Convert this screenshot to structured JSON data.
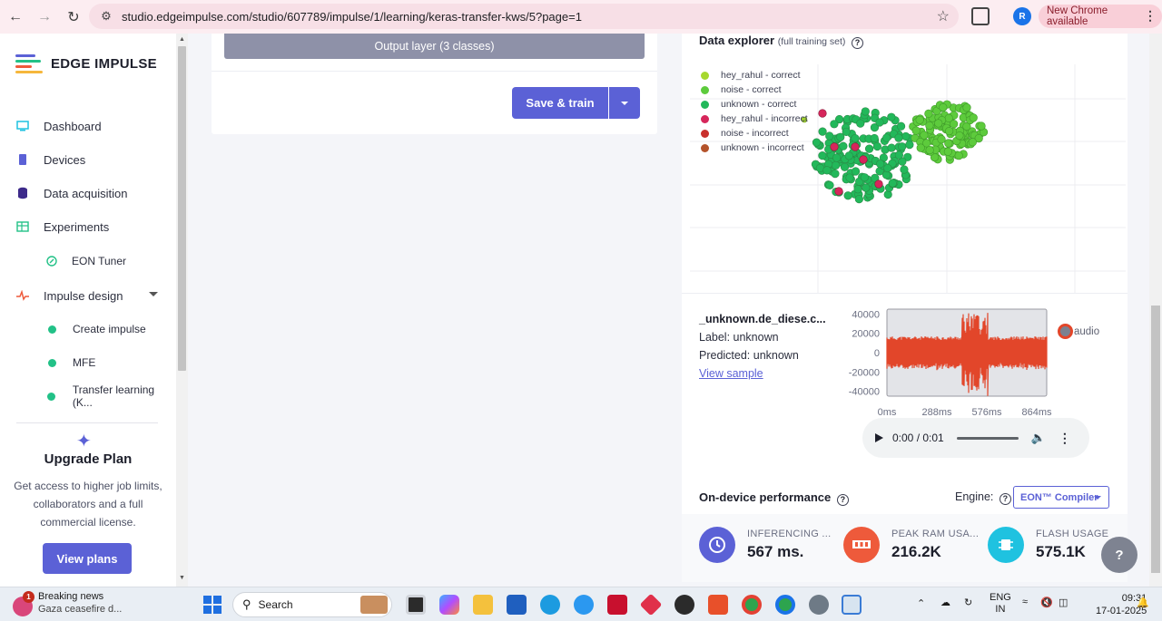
{
  "browser": {
    "url": "studio.edgeimpulse.com/studio/607789/impulse/1/learning/keras-transfer-kws/5?page=1",
    "profile_initial": "R",
    "new_chrome_label": "New Chrome available"
  },
  "sidebar": {
    "logo_text": "EDGE IMPULSE",
    "items": [
      {
        "label": "Dashboard",
        "icon": "monitor-icon"
      },
      {
        "label": "Devices",
        "icon": "chip-icon"
      },
      {
        "label": "Data acquisition",
        "icon": "database-icon"
      },
      {
        "label": "Experiments",
        "icon": "grid-icon"
      },
      {
        "label": "EON Tuner",
        "icon": "compass-icon"
      },
      {
        "label": "Impulse design",
        "icon": "pulse-icon"
      },
      {
        "label": "Create impulse",
        "icon": "dot-icon"
      },
      {
        "label": "MFE",
        "icon": "dot-icon"
      },
      {
        "label": "Transfer learning (K..."
      }
    ],
    "upgrade": {
      "title": "Upgrade Plan",
      "text": "Get access to higher job limits, collaborators and a full commercial license.",
      "button": "View plans"
    }
  },
  "main": {
    "output_layer": "Output layer (3 classes)",
    "save_train": "Save & train"
  },
  "data_explorer": {
    "title": "Data explorer",
    "subtitle": "(full training set)",
    "legend": [
      {
        "label": "hey_rahul - correct",
        "color": "#a6d82e"
      },
      {
        "label": "noise - correct",
        "color": "#5dcb3c"
      },
      {
        "label": "unknown - correct",
        "color": "#22b85a"
      },
      {
        "label": "hey_rahul - incorrect",
        "color": "#d6265b"
      },
      {
        "label": "noise - incorrect",
        "color": "#c9302c"
      },
      {
        "label": "unknown - incorrect",
        "color": "#b4532a"
      }
    ]
  },
  "sample": {
    "name": "_unknown.de_diese.c...",
    "label": "Label: unknown",
    "predicted": "Predicted: unknown",
    "view_link": "View sample",
    "legend_label": "audio",
    "wave_color": "#e2462a"
  },
  "chart_data": {
    "type": "line",
    "x_tick_labels": [
      "0ms",
      "288ms",
      "576ms",
      "864ms"
    ],
    "y_tick_labels": [
      "40000",
      "20000",
      "0",
      "-20000",
      "-40000"
    ],
    "ylim": [
      -45000,
      45000
    ],
    "series": [
      {
        "name": "audio",
        "color": "#e2462a"
      }
    ]
  },
  "player": {
    "time": "0:00 / 0:01"
  },
  "performance": {
    "title": "On-device performance",
    "engine_label": "Engine:",
    "engine_value": "EON™ Compiler",
    "metrics": [
      {
        "label": "INFERENCING ...",
        "value": "567 ms.",
        "color": "#5b61d6",
        "icon": "clock-icon"
      },
      {
        "label": "PEAK RAM USA...",
        "value": "216.2K",
        "color": "#ee5a3b",
        "icon": "ram-icon"
      },
      {
        "label": "FLASH USAGE",
        "value": "575.1K",
        "color": "#1fc2e0",
        "icon": "flash-chip-icon"
      }
    ]
  },
  "taskbar": {
    "news_badge": "1",
    "news_title": "Breaking news",
    "news_text": "Gaza ceasefire d...",
    "search_label": "Search",
    "lang_1": "ENG",
    "lang_2": "IN",
    "time": "09:31",
    "date": "17-01-2025"
  }
}
